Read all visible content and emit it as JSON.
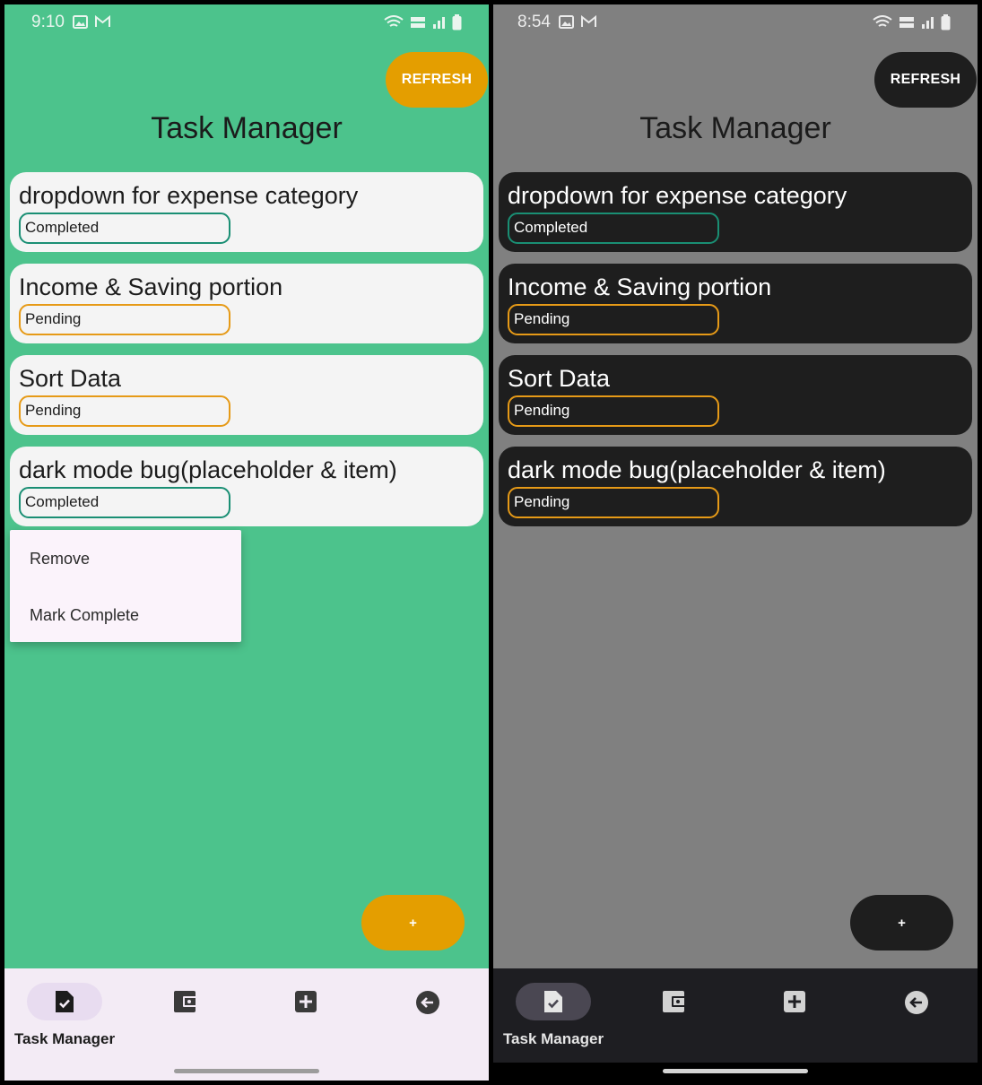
{
  "screens": [
    {
      "theme": "light",
      "status_time": "9:10",
      "refresh_label": "REFRESH",
      "title": "Task Manager",
      "tasks": [
        {
          "title": "dropdown for expense category",
          "status": "Completed"
        },
        {
          "title": "Income & Saving portion",
          "status": "Pending"
        },
        {
          "title": "Sort Data",
          "status": "Pending"
        },
        {
          "title": "dark mode bug(placeholder & item)",
          "status": "Completed"
        }
      ],
      "context_menu": [
        "Remove",
        "Mark Complete"
      ],
      "fab_label": "+",
      "nav": {
        "active_label": "Task Manager",
        "items": [
          "task-icon",
          "wallet-icon",
          "add-box-icon",
          "back-icon"
        ]
      }
    },
    {
      "theme": "dark",
      "status_time": "8:54",
      "refresh_label": "REFRESH",
      "title": "Task Manager",
      "tasks": [
        {
          "title": "dropdown for expense category",
          "status": "Completed"
        },
        {
          "title": "Income & Saving portion",
          "status": "Pending"
        },
        {
          "title": "Sort Data",
          "status": "Pending"
        },
        {
          "title": "dark mode bug(placeholder & item)",
          "status": "Pending"
        }
      ],
      "fab_label": "+",
      "nav": {
        "active_label": "Task Manager",
        "items": [
          "task-icon",
          "wallet-icon",
          "add-box-icon",
          "back-icon"
        ]
      }
    }
  ],
  "colors": {
    "light_background": "#4cc38c",
    "dark_background": "#808080",
    "accent_orange": "#e49e00",
    "completed_border": "#1a8f74",
    "pending_border": "#e69a17"
  }
}
